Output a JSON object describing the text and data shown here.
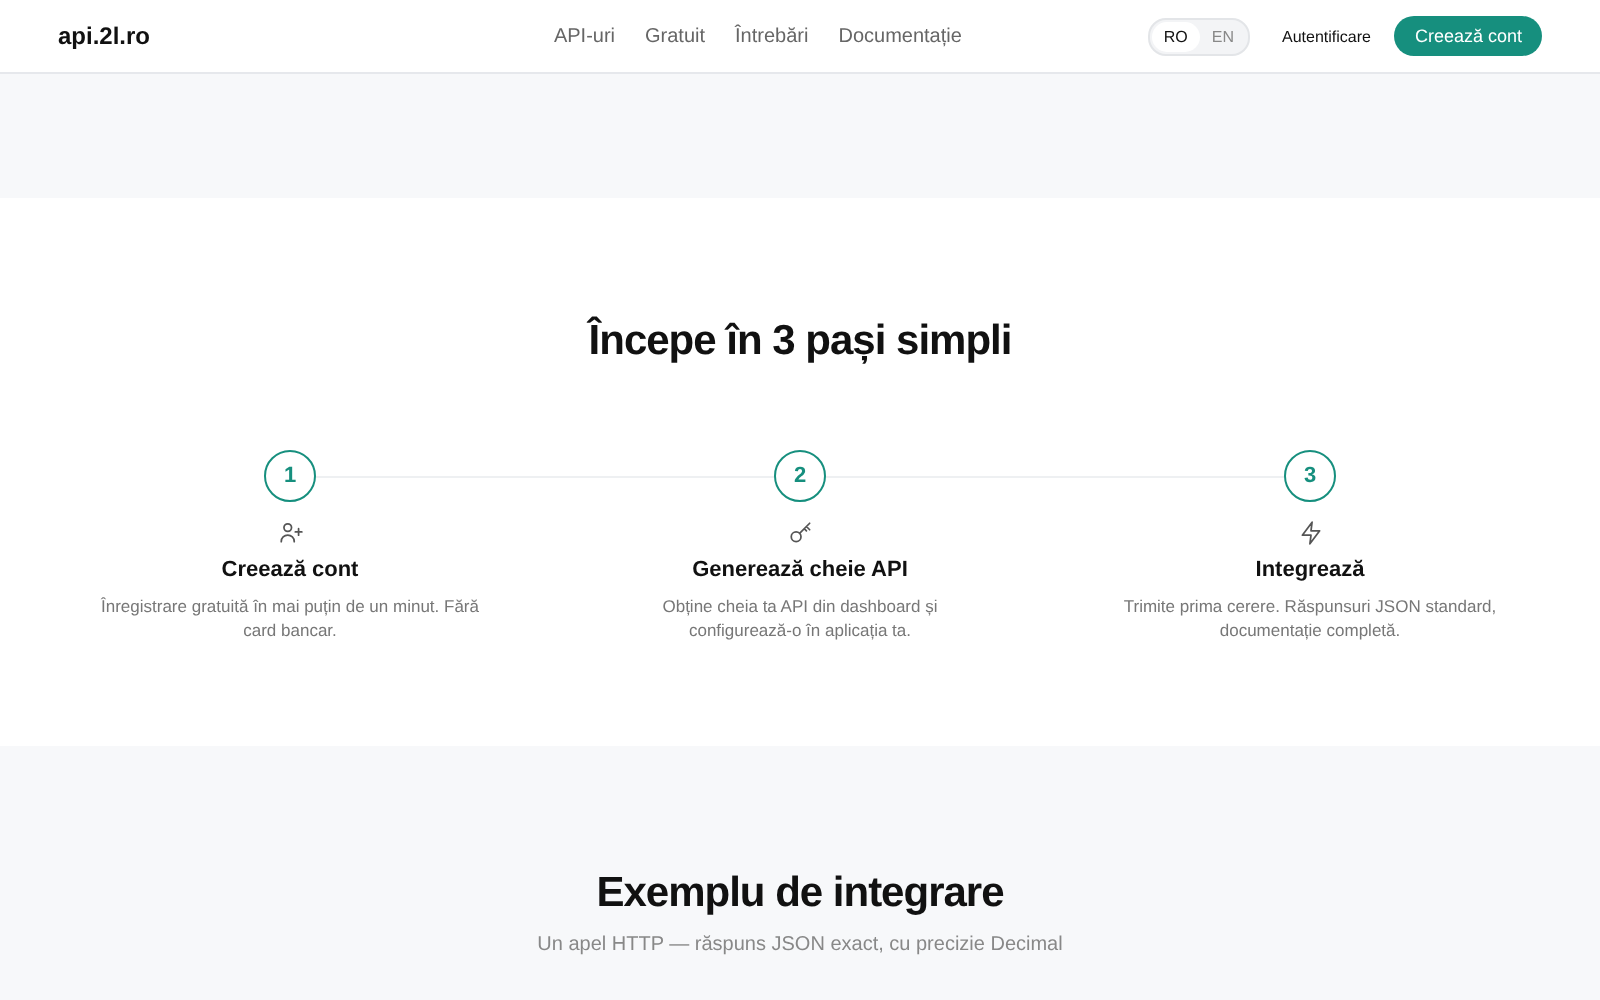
{
  "header": {
    "logo": "api.2l.ro",
    "nav": [
      "API-uri",
      "Gratuit",
      "Întrebări",
      "Documentație"
    ],
    "languages": [
      {
        "label": "RO",
        "selected": true
      },
      {
        "label": "EN",
        "selected": false
      }
    ],
    "login": "Autentificare",
    "signup": "Creează cont"
  },
  "steps_section": {
    "title": "Începe în 3 pași simpli",
    "steps": [
      {
        "number": "1",
        "title": "Creează cont",
        "text": "Înregistrare gratuită în mai puțin de un minut. Fără card bancar."
      },
      {
        "number": "2",
        "title": "Generează cheie API",
        "text": "Obține cheia ta API din dashboard și configurează-o în aplicația ta."
      },
      {
        "number": "3",
        "title": "Integrează",
        "text": "Trimite prima cerere. Răspunsuri JSON standard, documentație completă."
      }
    ]
  },
  "example_section": {
    "title": "Exemplu de integrare",
    "subtitle": "Un apel HTTP — răspuns JSON exact, cu precizie Decimal"
  }
}
